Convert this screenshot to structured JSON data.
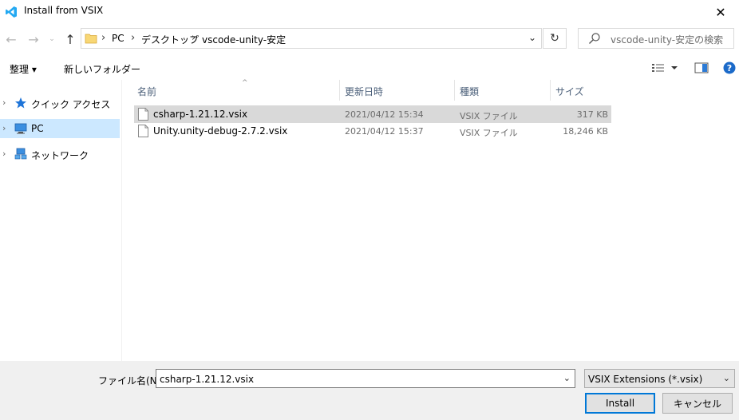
{
  "window": {
    "title": "Install from VSIX",
    "close_glyph": "✕"
  },
  "nav": {
    "back_glyph": "←",
    "forward_glyph": "→",
    "recent_glyph": "⌄",
    "up_glyph": "↑",
    "refresh_glyph": "↻"
  },
  "address": {
    "crumbs": [
      "PC",
      "デスクトップ",
      "vscode-unity-安定"
    ],
    "separator": "›",
    "dropdown_glyph": "⌄"
  },
  "search": {
    "placeholder": "vscode-unity-安定の検索"
  },
  "toolbar": {
    "organize_label": "整理 ▾",
    "new_folder_label": "新しいフォルダー"
  },
  "sidebar": {
    "chevron": "›",
    "items": [
      {
        "label": "クイック アクセス",
        "icon": "star-icon"
      },
      {
        "label": "PC",
        "icon": "computer-icon",
        "selected": true
      },
      {
        "label": "ネットワーク",
        "icon": "network-icon"
      }
    ]
  },
  "columns": {
    "name": "名前",
    "date": "更新日時",
    "type": "種類",
    "size": "サイズ",
    "sort_glyph": "^"
  },
  "files": [
    {
      "name": "csharp-1.21.12.vsix",
      "date": "2021/04/12 15:34",
      "type": "VSIX ファイル",
      "size": "317 KB",
      "selected": true
    },
    {
      "name": "Unity.unity-debug-2.7.2.vsix",
      "date": "2021/04/12 15:37",
      "type": "VSIX ファイル",
      "size": "18,246 KB",
      "selected": false
    }
  ],
  "footer": {
    "filename_label": "ファイル名(N):",
    "filename_value": "csharp-1.21.12.vsix",
    "filter_value": "VSIX Extensions (*.vsix)",
    "dropdown_glyph": "⌄",
    "install_label": "Install",
    "cancel_label": "キャンセル"
  },
  "colors": {
    "accent": "#0078d7",
    "selected_nav": "#cce8ff",
    "selected_row": "#d9d9d9",
    "vscode_blue": "#23a9f2"
  }
}
